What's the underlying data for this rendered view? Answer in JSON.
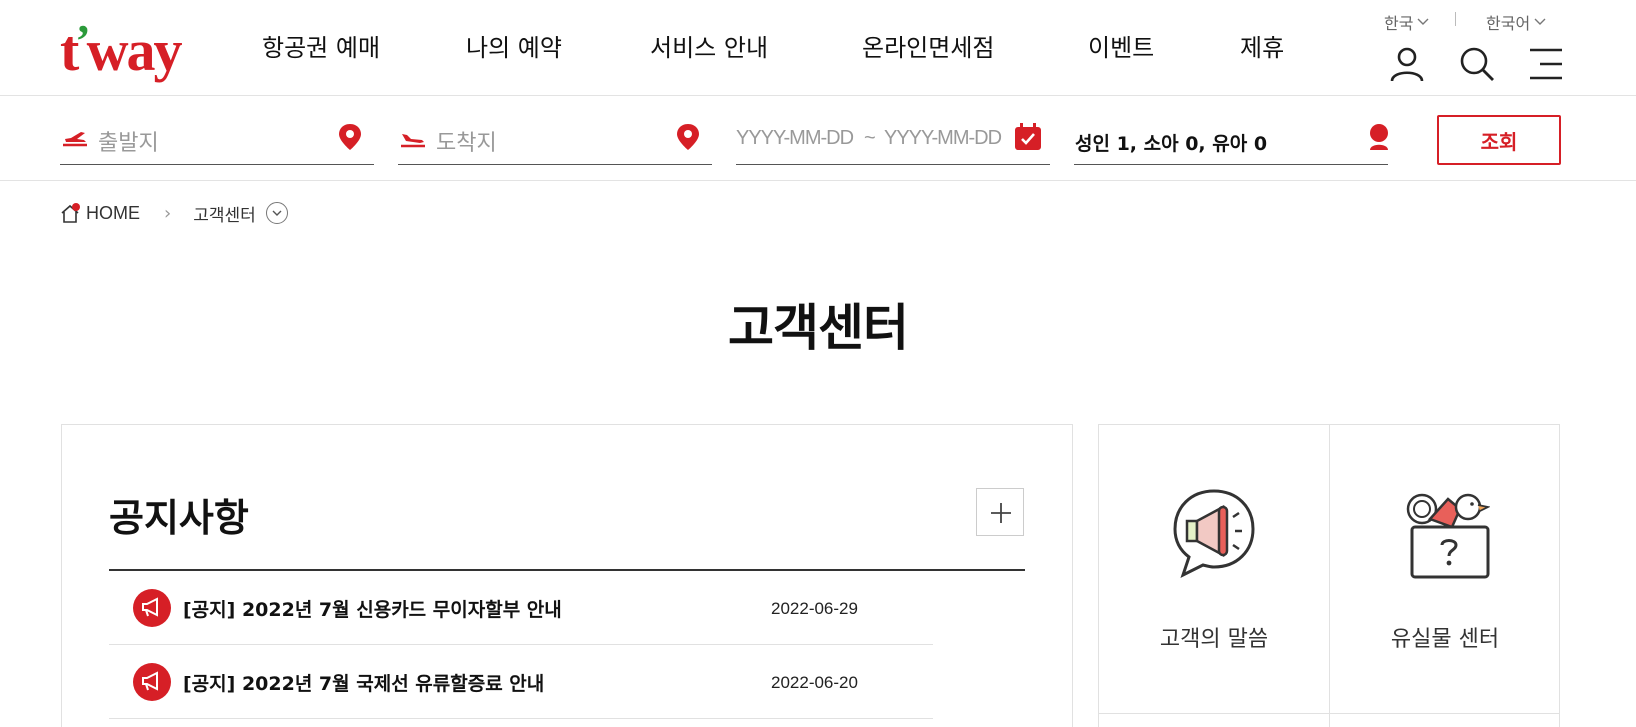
{
  "brand": {
    "logo_main": "t",
    "logo_apostrophe": "’",
    "logo_rest": "way"
  },
  "gnb": [
    "항공권 예매",
    "나의 예약",
    "서비스 안내",
    "온라인면세점",
    "이벤트",
    "제휴"
  ],
  "utility": {
    "country": "한국",
    "language": "한국어"
  },
  "search": {
    "departure_placeholder": "출발지",
    "arrival_placeholder": "도착지",
    "date_start_placeholder": "YYYY-MM-DD",
    "date_sep": "~",
    "date_end_placeholder": "YYYY-MM-DD",
    "passengers": "성인 1, 소아 0, 유아 0",
    "submit_label": "조회"
  },
  "breadcrumb": {
    "home": "HOME",
    "current": "고객센터"
  },
  "page": {
    "title": "고객센터"
  },
  "notice": {
    "title": "공지사항",
    "items": [
      {
        "title": "[공지] 2022년 7월 신용카드 무이자할부 안내",
        "date": "2022-06-29"
      },
      {
        "title": "[공지] 2022년 7월 국제선 유류할증료 안내",
        "date": "2022-06-20"
      }
    ]
  },
  "quick_menu": [
    {
      "label": "고객의 말씀",
      "icon": "megaphone-speech-icon"
    },
    {
      "label": "유실물 센터",
      "icon": "lost-and-found-box-icon"
    }
  ],
  "colors": {
    "brand_red": "#d61f26",
    "brand_green": "#2b9a3a"
  }
}
